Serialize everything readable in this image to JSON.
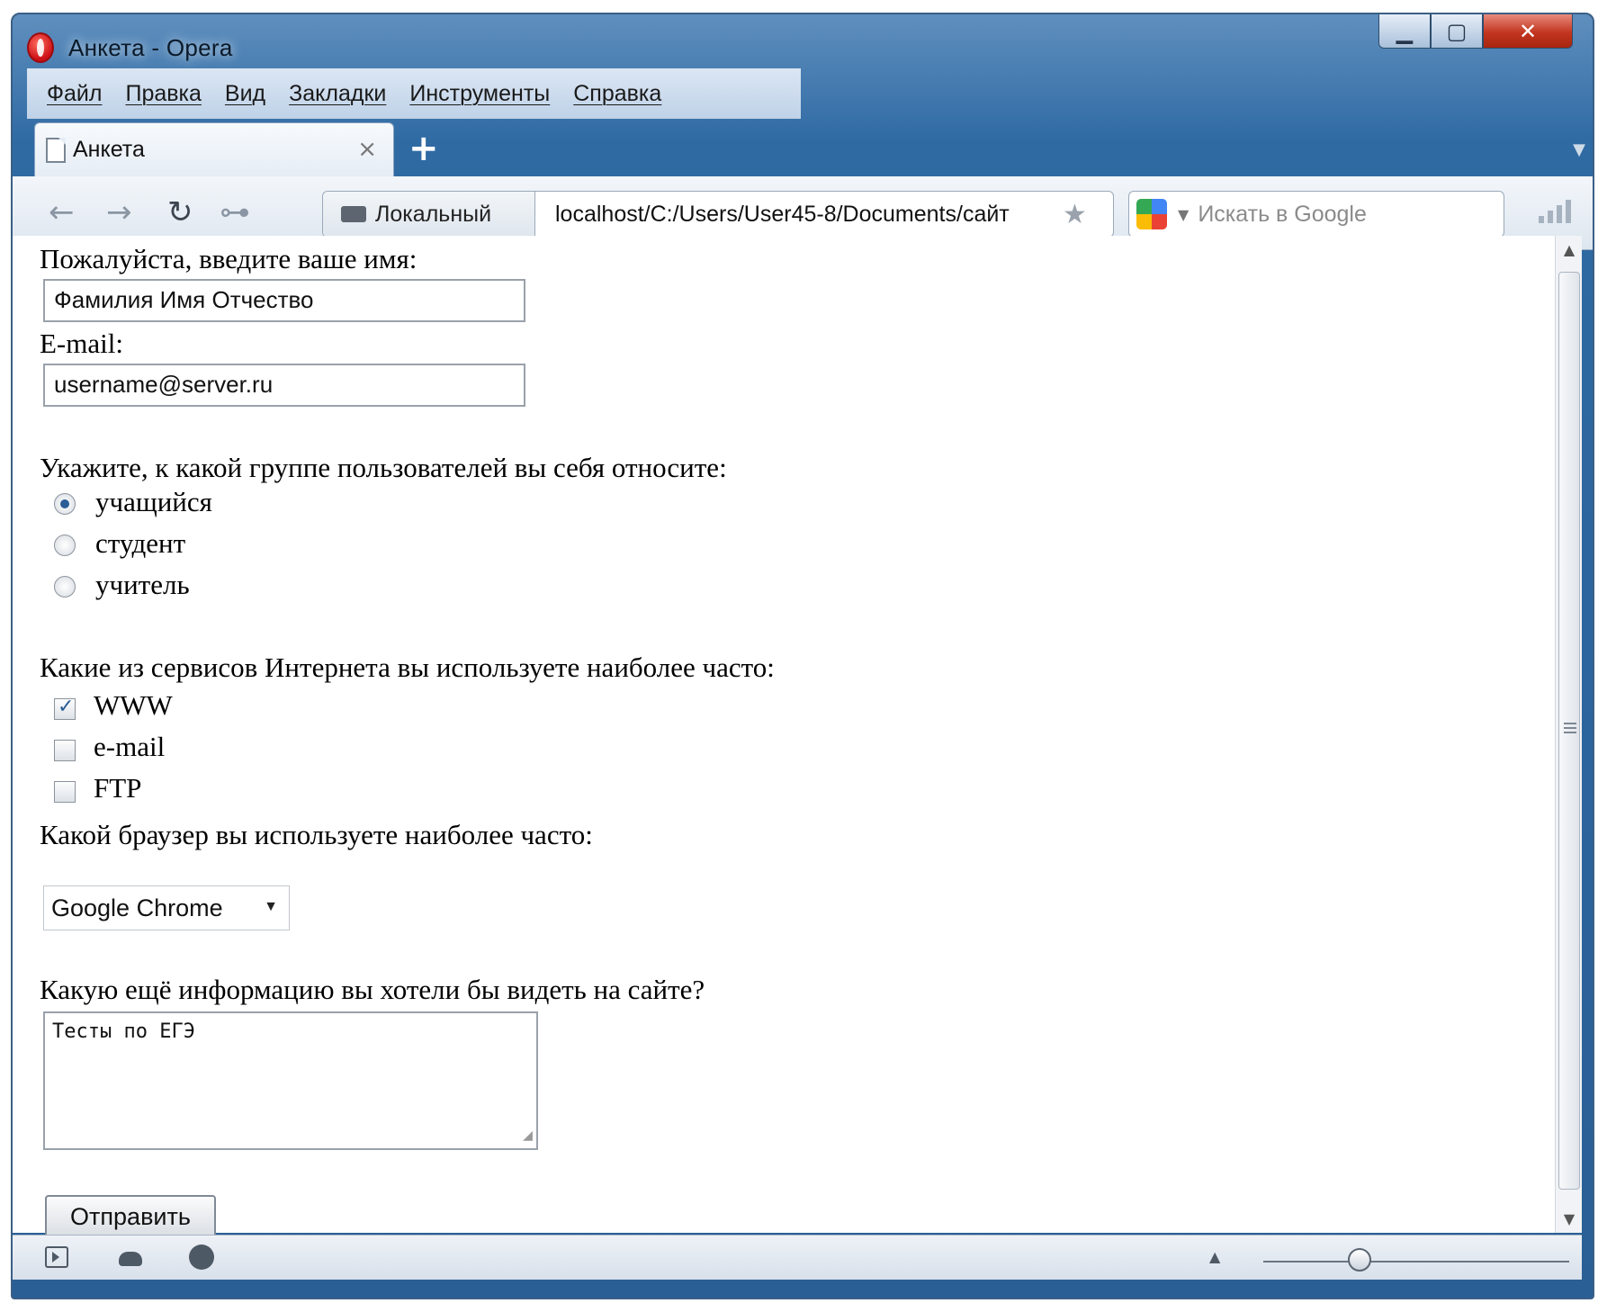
{
  "window": {
    "title": "Анкета - Opera",
    "controls": [
      "minimize",
      "maximize",
      "close"
    ]
  },
  "menu": [
    "Файл",
    "Правка",
    "Вид",
    "Закладки",
    "Инструменты",
    "Справка"
  ],
  "tab": {
    "label": "Анкета",
    "close": "×",
    "new_tab": "+"
  },
  "toolbar": {
    "security_badge": "Локальный",
    "url": "localhost/C:/Users/User45-8/Documents/сайт",
    "search_placeholder": "Искать в Google"
  },
  "form": {
    "name_label": "Пожалуйста, введите ваше имя:",
    "name_value": "Фамилия Имя Отчество",
    "email_label": "E-mail:",
    "email_value": "username@server.ru",
    "group_label": "Укажите, к какой группе пользователей вы себя относите:",
    "groups": [
      {
        "label": "учащийся",
        "checked": true
      },
      {
        "label": "студент",
        "checked": false
      },
      {
        "label": "учитель",
        "checked": false
      }
    ],
    "services_label": "Какие из сервисов Интернета вы используете наиболее часто:",
    "services": [
      {
        "label": "WWW",
        "checked": true
      },
      {
        "label": "e-mail",
        "checked": false
      },
      {
        "label": "FTP",
        "checked": false
      }
    ],
    "browser_label": "Какой браузер вы используете наиболее часто:",
    "browser_selected": "Google Chrome",
    "info_label": "Какую ещё информацию вы хотели бы видеть на сайте?",
    "info_value": "Тесты по ЕГЭ",
    "submit_label": "Отправить"
  },
  "colors": {
    "titlebar": "#2f6aa3",
    "close_button": "#c2351f",
    "accent": "#2a5c96"
  }
}
